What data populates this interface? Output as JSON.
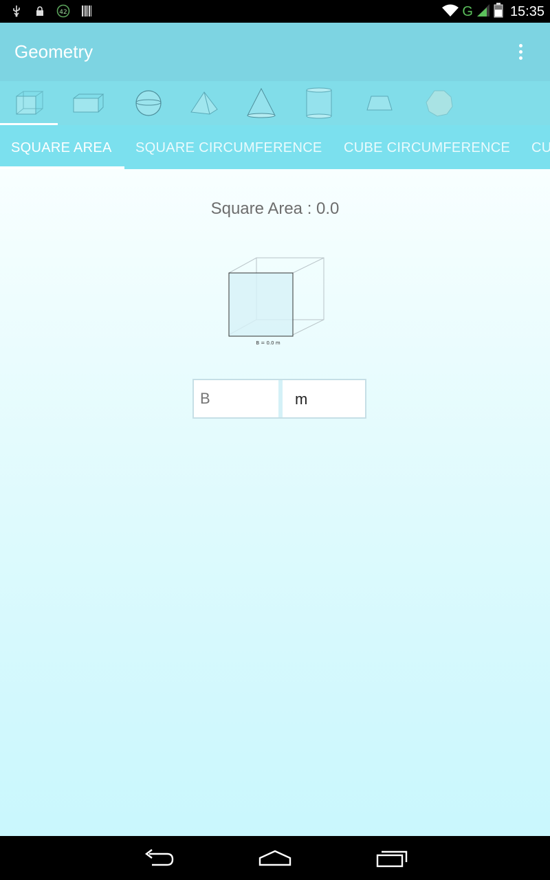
{
  "status_bar": {
    "time": "15:35",
    "network": "G",
    "notification_badge": "42",
    "icons": [
      "usb-icon",
      "lock-icon",
      "counter-badge-icon",
      "barcode-icon",
      "wifi-icon",
      "signal-icon",
      "battery-icon"
    ]
  },
  "action_bar": {
    "title": "Geometry",
    "overflow_icon": "more-vertical-icon"
  },
  "shape_tabs": {
    "selected": "cube",
    "items": [
      "cube",
      "cuboid",
      "sphere",
      "pyramid",
      "cone",
      "cylinder",
      "trapezoid",
      "polygon"
    ]
  },
  "tabs": {
    "items": [
      {
        "label": "SQUARE AREA",
        "selected": true
      },
      {
        "label": "SQUARE CIRCUMFERENCE",
        "selected": false
      },
      {
        "label": "CUBE CIRCUMFERENCE",
        "selected": false
      },
      {
        "label": "CU",
        "selected": false
      }
    ]
  },
  "main": {
    "result_text": "Square Area : 0.0",
    "diagram_label": "B = 0.0 m",
    "input_placeholder": "B",
    "unit": "m"
  },
  "colors": {
    "action_bar": "#7dd4e2",
    "shape_bar": "#81dde9",
    "tab_bar": "#7be0ee",
    "text_gray": "#6d6d6d"
  },
  "nav_bar": {
    "icons": [
      "back-icon",
      "home-icon",
      "recents-icon"
    ]
  }
}
